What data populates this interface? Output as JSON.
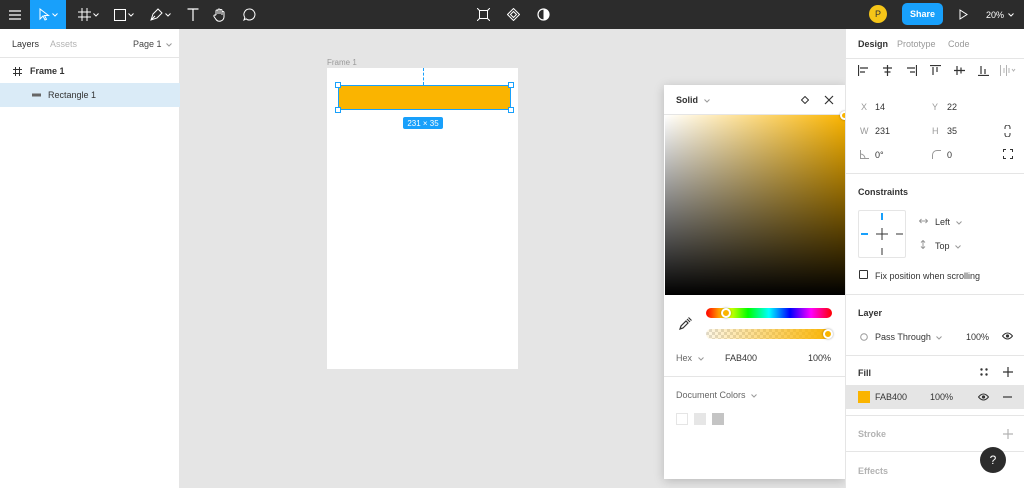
{
  "toolbar": {
    "share_label": "Share",
    "avatar_initial": "P",
    "zoom": "20%"
  },
  "left_panel": {
    "tab_layers": "Layers",
    "tab_assets": "Assets",
    "page_selector": "Page 1",
    "layers": [
      {
        "label": "Frame 1"
      },
      {
        "label": "Rectangle 1"
      }
    ]
  },
  "canvas": {
    "frame_label": "Frame 1",
    "dimension_badge": "231 × 35",
    "rect_color": "#FAB400",
    "selection_color": "#18A0FB"
  },
  "color_picker": {
    "mode": "Solid",
    "format": "Hex",
    "hex_value": "FAB400",
    "opacity": "100%",
    "document_colors_label": "Document Colors",
    "swatches": [
      "#ffffff",
      "#e6e6e6",
      "#c4c4c4"
    ]
  },
  "right_panel": {
    "tab_design": "Design",
    "tab_prototype": "Prototype",
    "tab_code": "Code",
    "x_label": "X",
    "x_value": "14",
    "y_label": "Y",
    "y_value": "22",
    "w_label": "W",
    "w_value": "231",
    "h_label": "H",
    "h_value": "35",
    "rotation": "0°",
    "radius": "0",
    "constraints_title": "Constraints",
    "constraint_h": "Left",
    "constraint_v": "Top",
    "fix_position_label": "Fix position when scrolling",
    "layer_title": "Layer",
    "blend_mode": "Pass Through",
    "layer_opacity": "100%",
    "fill_title": "Fill",
    "fill_hex": "FAB400",
    "fill_opacity": "100%",
    "stroke_title": "Stroke",
    "effects_title": "Effects"
  },
  "help_label": "?"
}
